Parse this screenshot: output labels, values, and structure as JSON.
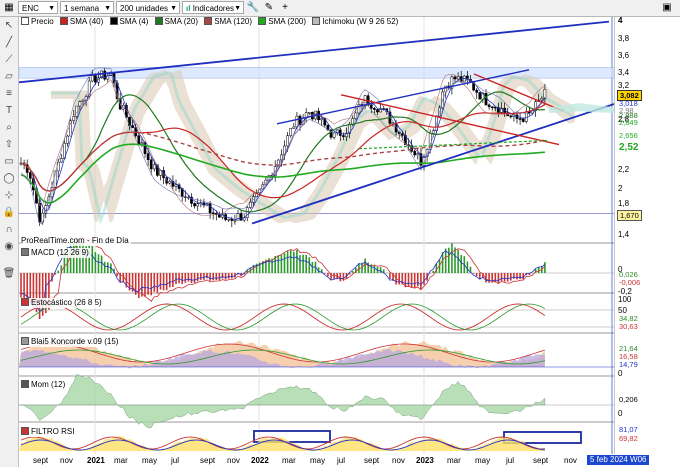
{
  "toolbar": {
    "symbol": "ENC",
    "period": "1 semana",
    "units": "200 unidades",
    "indicators_label": "Indicadores"
  },
  "legend": {
    "price": "Precio",
    "sma40": "SMA (40)",
    "sma4": "SMA (4)",
    "sma20": "SMA (20)",
    "sma120": "SMA (120)",
    "sma200": "SMA (200)",
    "ichimoku": "Ichimoku (W 9 26 52)",
    "source": "ProRealTime.com - Fin de Día"
  },
  "colors": {
    "price": "#000000",
    "sma40": "#cc2222",
    "sma4": "#2233cc",
    "sma20": "#227722",
    "sma120": "#aa4444",
    "sma200": "#22aa22",
    "channel": "#1f2fbf",
    "accent": "#1a48d0"
  },
  "panels": {
    "macd": "MACD (12 26 9)",
    "stoch": "Estocástico (26 8 5)",
    "blai5": "Blai5 Koncorde v.09 (15)",
    "mom": "Mom (12)",
    "filtro": "FILTRO RSI"
  },
  "price_axis": [
    "4",
    "3,8",
    "3,6",
    "3,4",
    "3,2",
    "3",
    "2,8",
    "2,6",
    "2,4",
    "2,2",
    "2",
    "1,8",
    "1,6",
    "1,4"
  ],
  "price_badges": {
    "last": "3,082",
    "b1": "3,018",
    "b2": "2,98",
    "b3": "2,888",
    "b4": "2,849",
    "b5": "2,656",
    "b6": "2,52",
    "b7": "1,670"
  },
  "macd_axis": {
    "a": "0",
    "b": "-0,2",
    "badge1": "0,026",
    "badge2": "-0,006"
  },
  "stoch_axis": {
    "a": "100",
    "b": "50",
    "badge1": "34,82",
    "badge2": "30,63"
  },
  "blai5_axis": {
    "badge1": "21,64",
    "badge2": "16,58",
    "badge3": "14,79",
    "badge4": "0"
  },
  "mom_axis": {
    "badge1": "0,206",
    "badge2": "0"
  },
  "filtro_axis": {
    "badge1": "81,07",
    "badge2": "69,82"
  },
  "time_axis": [
    "sept",
    "nov",
    "2021",
    "mar",
    "may",
    "jul",
    "sept",
    "nov",
    "2022",
    "mar",
    "may",
    "jul",
    "sept",
    "nov",
    "2023",
    "mar",
    "may",
    "jul",
    "sept",
    "nov"
  ],
  "date_badge": "5 feb 2024 W06"
}
